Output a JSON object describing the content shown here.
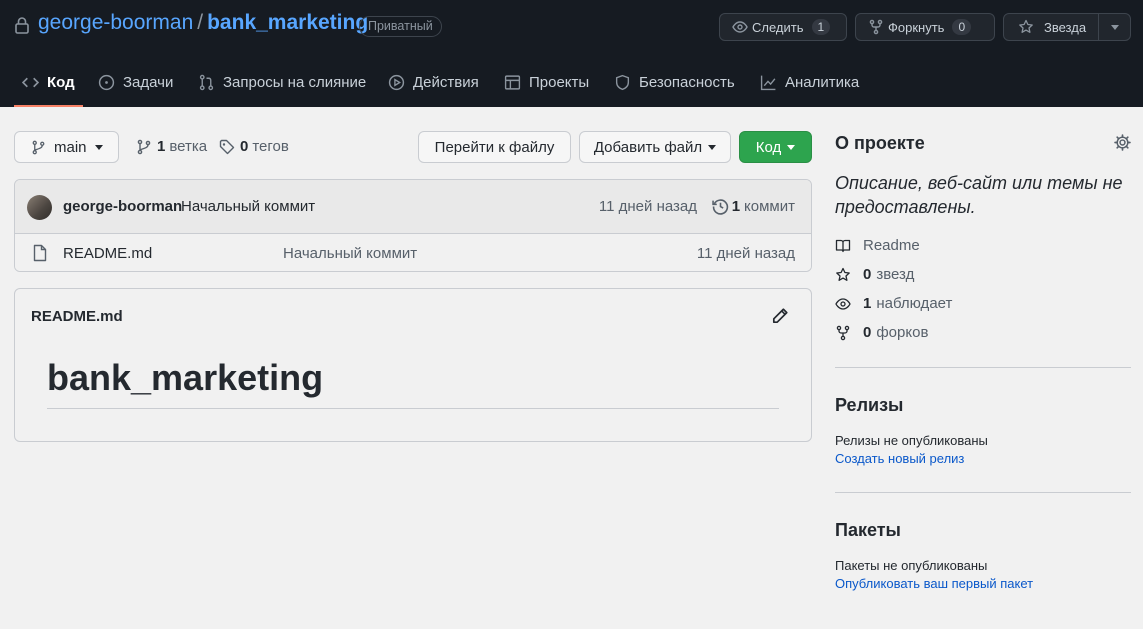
{
  "header": {
    "owner": "george-boorman",
    "separator": "/",
    "repo": "bank_marketing",
    "visibility": "Приватный",
    "watch": {
      "label": "Следить",
      "count": "1"
    },
    "fork": {
      "label": "Форкнуть",
      "count": "0"
    },
    "star": {
      "label": "Звезда"
    }
  },
  "tabs": [
    {
      "label": "Код",
      "icon": "code-icon",
      "active": true
    },
    {
      "label": "Задачи",
      "icon": "issue-icon"
    },
    {
      "label": "Запросы на слияние",
      "icon": "pull-request-icon"
    },
    {
      "label": "Действия",
      "icon": "play-icon"
    },
    {
      "label": "Проекты",
      "icon": "table-icon"
    },
    {
      "label": "Безопасность",
      "icon": "shield-icon"
    },
    {
      "label": "Аналитика",
      "icon": "graph-icon"
    }
  ],
  "controls": {
    "branch": "main",
    "branches_count": "1",
    "branches_label": "ветка",
    "tags_count": "0",
    "tags_label": "тегов",
    "goto_file": "Перейти к файлу",
    "add_file": "Добавить файл",
    "code": "Код"
  },
  "commit": {
    "author": "george-boorman",
    "message": "Начальный коммит",
    "time": "11 дней назад",
    "count": "1",
    "count_label": "коммит"
  },
  "files": [
    {
      "name": "README.md",
      "message": "Начальный коммит",
      "time": "11 дней назад"
    }
  ],
  "readme": {
    "title": "README.md",
    "heading": "bank_marketing"
  },
  "sidebar": {
    "about_title": "О проекте",
    "description": "Описание, веб-сайт или темы не предоставлены.",
    "readme_label": "Readme",
    "stars_count": "0",
    "stars_label": "звезд",
    "watchers_count": "1",
    "watchers_label": "наблюдает",
    "forks_count": "0",
    "forks_label": "форков",
    "releases_title": "Релизы",
    "releases_text": "Релизы не опубликованы",
    "releases_link": "Создать новый релиз",
    "packages_title": "Пакеты",
    "packages_text": "Пакеты не опубликованы",
    "packages_link": "Опубликовать ваш первый пакет"
  },
  "colors": {
    "header_bg": "#161b22",
    "link": "#58a6ff",
    "primary_green": "#2da44e",
    "tab_underline": "#f78166"
  }
}
